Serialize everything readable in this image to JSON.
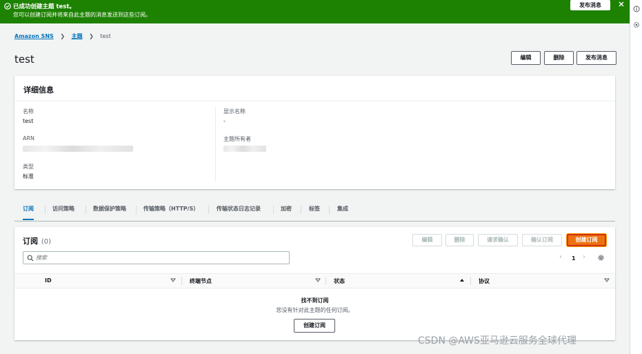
{
  "flash": {
    "title": "已成功创建主题 test。",
    "message": "您可以创建订阅并将来自此主题的消息发送到这些订阅。",
    "publish_label": "发布消息",
    "color": "#1d8102"
  },
  "breadcrumb": {
    "root": "Amazon SNS",
    "parent": "主题",
    "current": "test"
  },
  "page": {
    "title": "test",
    "actions": {
      "edit": "编辑",
      "delete": "删除",
      "publish": "发布消息"
    }
  },
  "details": {
    "heading": "详细信息",
    "name_label": "名称",
    "name_value": "test",
    "arn_label": "ARN",
    "type_label": "类型",
    "type_value": "标准",
    "display_name_label": "显示名称",
    "display_name_value": "-",
    "owner_label": "主题所有者"
  },
  "tabs": [
    "订阅",
    "访问策略",
    "数据保护策略",
    "传输策略（HTTP/S）",
    "传输状态日志记录",
    "加密",
    "标签",
    "集成"
  ],
  "subscriptions": {
    "heading": "订阅",
    "count": "(0)",
    "buttons": {
      "edit": "编辑",
      "delete": "删除",
      "request_confirm": "请求确认",
      "confirm": "确认订阅",
      "create": "创建订阅"
    },
    "search_placeholder": "搜索",
    "page_number": "1",
    "columns": {
      "id": "ID",
      "endpoint": "终端节点",
      "status": "状态",
      "protocol": "协议"
    },
    "empty_title": "找不到订阅",
    "empty_message": "您没有针对此主题的任何订阅。",
    "empty_create": "创建订阅",
    "accent": "#ec7211"
  },
  "icons": {
    "flash_status": "check-circle-icon",
    "flash_close": "close-icon",
    "breadcrumb_sep": "chevron-right-icon",
    "search": "search-icon",
    "settings": "gear-icon",
    "sort": "caret-down-icon",
    "sort_active": "caret-up-icon"
  },
  "watermark": "CSDN @AWS亚马逊云服务全球代理"
}
